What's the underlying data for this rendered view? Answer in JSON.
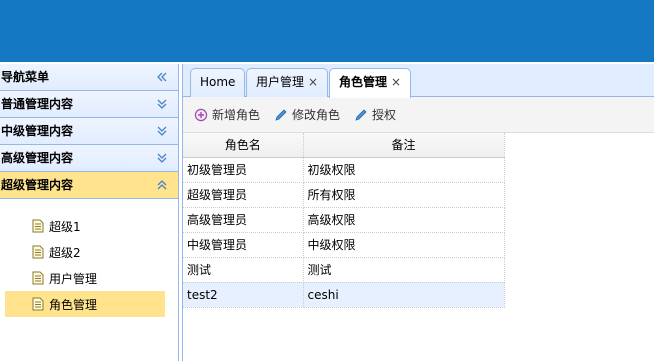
{
  "sidebar": {
    "title": "导航菜单",
    "sections": [
      {
        "label": "普通管理内容",
        "state": "collapsed"
      },
      {
        "label": "中级管理内容",
        "state": "collapsed"
      },
      {
        "label": "高级管理内容",
        "state": "collapsed"
      },
      {
        "label": "超级管理内容",
        "state": "expanded"
      }
    ],
    "tree_items": [
      "超级1",
      "超级2",
      "用户管理",
      "角色管理"
    ],
    "selected_tree_item": "角色管理"
  },
  "tabs": [
    {
      "label": "Home",
      "closable": false
    },
    {
      "label": "用户管理",
      "closable": true
    },
    {
      "label": "角色管理",
      "closable": true,
      "active": true
    }
  ],
  "close_glyph": "×",
  "toolbar": {
    "add_role": "新增角色",
    "edit_role": "修改角色",
    "authorize": "授权"
  },
  "grid": {
    "columns": [
      "角色名",
      "备注"
    ],
    "rows": [
      [
        "初级管理员",
        "初级权限"
      ],
      [
        "超级管理员",
        "所有权限"
      ],
      [
        "高级管理员",
        "高级权限"
      ],
      [
        "中级管理员",
        "中级权限"
      ],
      [
        "测试",
        "测试"
      ],
      [
        "test2",
        "ceshi"
      ]
    ]
  },
  "colors": {
    "header": "#1478c2",
    "selected": "#ffe48d",
    "panel_border": "#95b8e7",
    "row_hover": "#e6f0ff"
  },
  "icons": [
    "double-left-chevron-icon",
    "double-down-chevron-icon",
    "double-up-chevron-icon",
    "document-icon",
    "plus-circle-icon",
    "pencil-icon"
  ]
}
